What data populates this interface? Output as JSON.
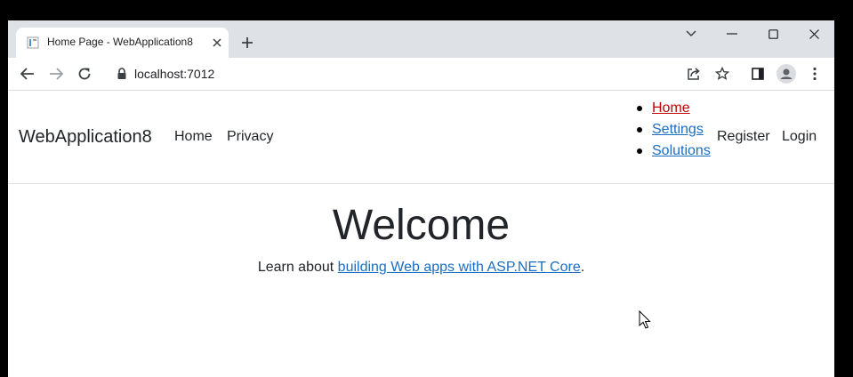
{
  "browser": {
    "tab": {
      "title": "Home Page - WebApplication8"
    },
    "address": {
      "url": "localhost:7012"
    }
  },
  "site": {
    "brand": "WebApplication8",
    "nav_left": [
      "Home",
      "Privacy"
    ],
    "nav_list": [
      {
        "label": "Home",
        "color": "#c00000"
      },
      {
        "label": "Settings",
        "color": "#1b6ec2"
      },
      {
        "label": "Solutions",
        "color": "#1b6ec2"
      }
    ],
    "nav_right": [
      "Register",
      "Login"
    ]
  },
  "main": {
    "heading": "Welcome",
    "learn_prefix": "Learn about ",
    "learn_link": "building Web apps with ASP.NET Core",
    "learn_suffix": "."
  },
  "colors": {
    "tabstrip": "#dee1e6",
    "link": "#1b6ec2",
    "active_link": "#c00000",
    "text": "#212529"
  },
  "icons": [
    "page-favicon-icon",
    "close-icon",
    "plus-icon",
    "chevron-down-icon",
    "minimize-icon",
    "maximize-icon",
    "window-close-icon",
    "back-arrow-icon",
    "forward-arrow-icon",
    "reload-icon",
    "lock-icon",
    "share-icon",
    "star-icon",
    "side-panel-icon",
    "profile-icon",
    "more-vert-icon",
    "mouse-cursor-icon"
  ]
}
